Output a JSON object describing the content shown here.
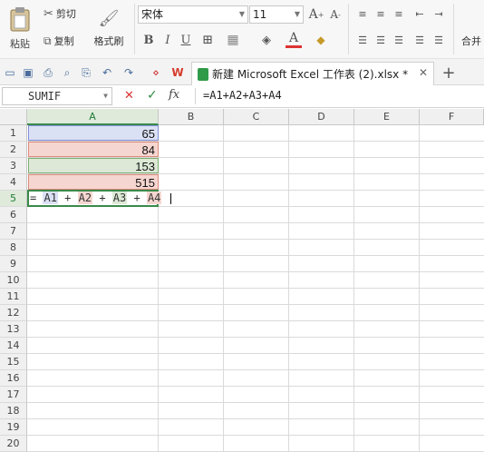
{
  "ribbon": {
    "paste_label": "粘贴",
    "cut_label": "剪切",
    "copy_label": "复制",
    "format_painter_label": "格式刷",
    "font_name": "宋体",
    "font_size": "11",
    "merge_label": "合并"
  },
  "tabbar": {
    "doc_title": "新建 Microsoft Excel 工作表 (2).xlsx *"
  },
  "formula_bar": {
    "name_box": "SUMIF",
    "fx_label": "fx",
    "formula": "=A1+A2+A3+A4"
  },
  "sheet": {
    "columns": [
      "A",
      "B",
      "C",
      "D",
      "E",
      "F"
    ],
    "rows": [
      "1",
      "2",
      "3",
      "4",
      "5",
      "6",
      "7",
      "8",
      "9",
      "10",
      "11",
      "12",
      "13",
      "14",
      "15",
      "16",
      "17",
      "18",
      "19",
      "20"
    ],
    "values": {
      "a1": "65",
      "a2": "84",
      "a3": "153",
      "a4": "515"
    },
    "edit": {
      "eq": "=",
      "r1": "A1",
      "p1": "+",
      "r2": "A2",
      "p2": "+",
      "r3": "A3",
      "p3": "+",
      "r4": "A4"
    }
  },
  "colors": {
    "ref_a1": "#dbe1f5",
    "ref_a2": "#f6d6d0",
    "ref_a3": "#dde9d6",
    "ref_a4": "#f6d6d0",
    "accent_green": "#3a8a4a"
  }
}
